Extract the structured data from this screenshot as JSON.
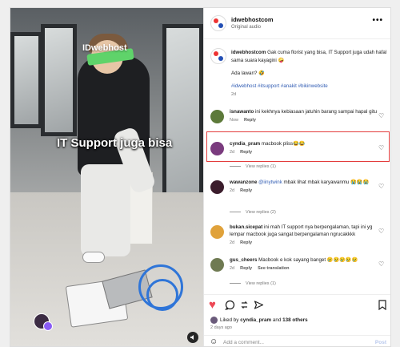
{
  "post": {
    "username": "idwebhostcom",
    "audio": "Original audio",
    "more_icon": "•••",
    "media": {
      "watermark": "IDwebhost",
      "overlay_text": "IT Support juga bisa"
    }
  },
  "caption": {
    "username": "idwebhostcom",
    "text": "Gak cuma florist yang bisa, IT Support juga udah hafal sama suara kayagini 🤪",
    "line2": "Ada lawan? 🤣",
    "hashtags": "#idwebhost #itsupport #anakit #bikinwebsite",
    "time": "2d"
  },
  "comments": [
    {
      "username": "isnawanto",
      "text": "ini kekhnya kebiasaan jatuhin barang sampai hapal gitu",
      "time": "Now",
      "reply": "Reply",
      "avatar_color": "#5d7a3a",
      "highlighted": true
    },
    {
      "username": "cyndia_pram",
      "text": "macbook pliss😂😂",
      "time": "2d",
      "reply": "Reply",
      "view_replies": "View replies (1)",
      "avatar_color": "#7a3b7e"
    },
    {
      "username": "wawanzone",
      "mention": "@iinytwink",
      "text": "mbak lihat mbak karyawanmu 😭😭😭",
      "time": "2d",
      "reply": "Reply",
      "view_replies": "View replies (2)",
      "avatar_color": "#3b1d2c"
    },
    {
      "username": "bukan.sicepat",
      "text": "ini mah IT support nya berpengalaman, tapi ini yg lempar macbook juga sangat berpengalaman ngrucakkkk",
      "time": "2d",
      "reply": "Reply",
      "avatar_color": "#e0a23b"
    },
    {
      "username": "gus_cheers",
      "text": "Macbook e kok sayang banget 😢😢😢😢😢",
      "time": "2d",
      "reply": "Reply",
      "translation": "See translation",
      "view_replies": "View replies (1)",
      "avatar_color": "#6f7a52"
    }
  ],
  "actions": {
    "like_icon": "♥",
    "comment_icon": "◯",
    "share_icon": "➤",
    "save_icon": "❐",
    "liked_by_prefix": "Liked by",
    "liked_by_user": "cyndia_pram",
    "liked_by_and": "and",
    "liked_by_count": "138 others",
    "date": "2 days ago",
    "add_comment_placeholder": "Add a comment...",
    "post_label": "Post"
  },
  "colors": {
    "highlight_border": "#e33d3d",
    "like_red": "#ed4956",
    "link_blue": "#335eb4"
  }
}
